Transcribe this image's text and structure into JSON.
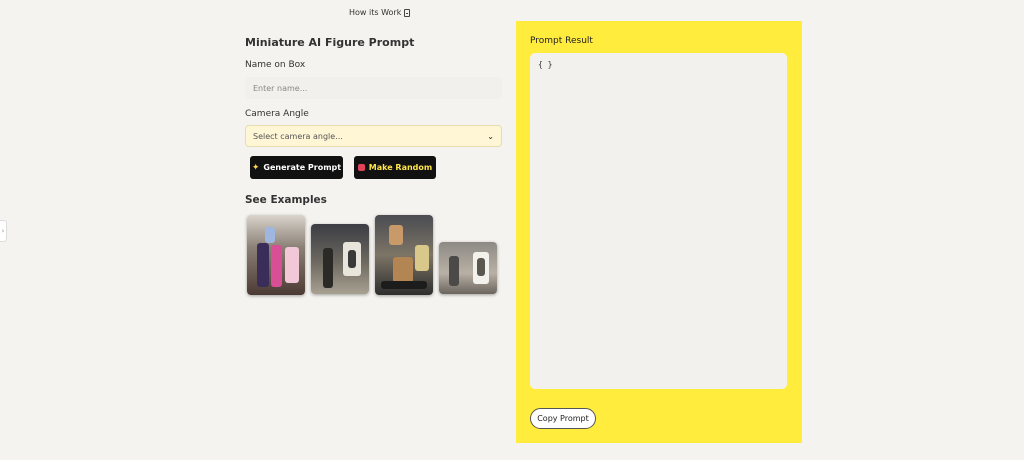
{
  "header": {
    "how_link": "How its Work"
  },
  "form": {
    "title": "Miniature AI Figure Prompt",
    "name_label": "Name on Box",
    "name_placeholder": "Enter name...",
    "name_value": "",
    "angle_label": "Camera Angle",
    "angle_selected": "Select camera angle...",
    "generate_label": "Generate Prompt",
    "random_label": "Make Random",
    "examples_title": "See Examples"
  },
  "result": {
    "title": "Prompt Result",
    "content": "{ }",
    "copy_label": "Copy Prompt"
  },
  "icons": {
    "generate": "sparkle-icon",
    "random": "dice-icon",
    "how": "document-icon",
    "toggle": "chevron-right-icon"
  },
  "colors": {
    "accent_yellow": "#ffec3d",
    "button_dark": "#111111",
    "random_text": "#ffe54a",
    "page_bg": "#f5f3ef"
  }
}
